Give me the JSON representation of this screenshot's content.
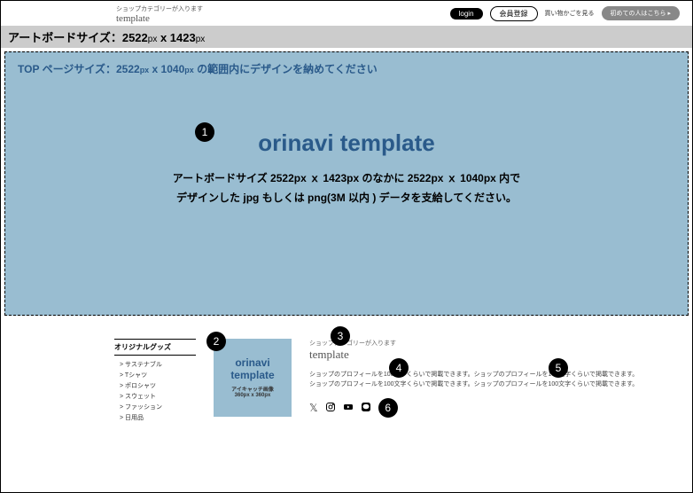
{
  "header": {
    "category_label": "ショップカテゴリーが入ります",
    "template_label": "template",
    "login": "login",
    "register": "会員登録",
    "cart": "買い物かごを見る",
    "first_time": "初めての人はこちら ▸"
  },
  "artboard": {
    "prefix": "アートボードサイズ：",
    "w": "2522",
    "h": "1423",
    "px": "px",
    "sep": " x "
  },
  "hero": {
    "top_prefix": "TOP ページサイズ：",
    "top_w": "2522",
    "top_h": "1040",
    "top_suffix": " の範囲内にデザインを納めてください",
    "title": "orinavi template",
    "desc1": "アートボードサイズ 2522px ｘ 1423px のなかに 2522px ｘ 1040px 内で",
    "desc2": "デザインした jpg もしくは png(3M 以内 ) データを支給してください。"
  },
  "sidebar": {
    "title": "オリジナルグッズ",
    "items": [
      "> サステナブル",
      "> Tシャツ",
      "> ポロシャツ",
      "> スウェット",
      "> ファッション",
      "> 日用品"
    ]
  },
  "thumb": {
    "title": "orinavi template",
    "caption": "アイキャッチ画像",
    "size": "360px x 360px"
  },
  "detail": {
    "category": "ショップカテゴリーが入ります",
    "name": "template",
    "profile": "ショップのプロフィールを100文字くらいで掲載できます。ショップのプロフィールを100文字くらいで掲載できます。ショップのプロフィールを100文字くらいで掲載できます。ショップのプロフィールを100文字くらいで掲載できます。"
  },
  "markers": {
    "m1": "1",
    "m2": "2",
    "m3": "3",
    "m4": "4",
    "m5": "5",
    "m6": "6"
  }
}
